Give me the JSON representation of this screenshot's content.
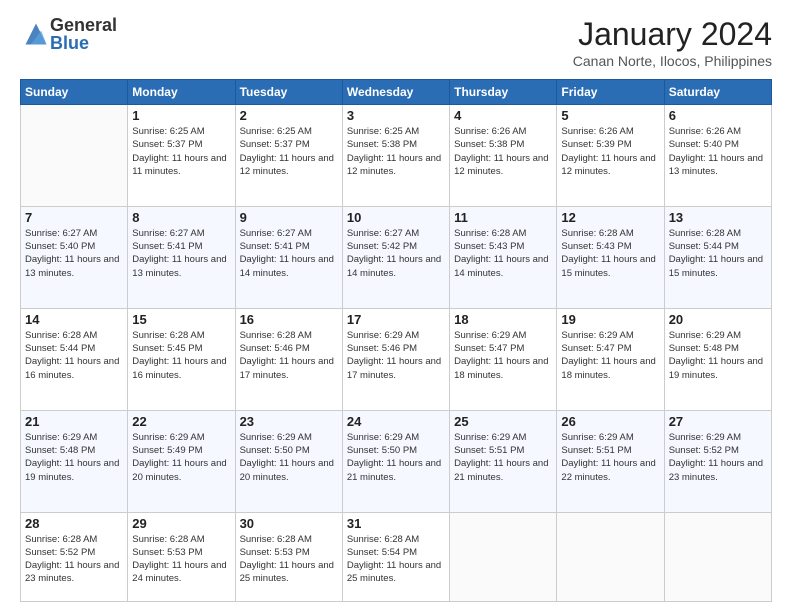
{
  "header": {
    "logo_general": "General",
    "logo_blue": "Blue",
    "month_title": "January 2024",
    "location": "Canan Norte, Ilocos, Philippines"
  },
  "days_of_week": [
    "Sunday",
    "Monday",
    "Tuesday",
    "Wednesday",
    "Thursday",
    "Friday",
    "Saturday"
  ],
  "weeks": [
    [
      {
        "day": "",
        "sunrise": "",
        "sunset": "",
        "daylight": ""
      },
      {
        "day": "1",
        "sunrise": "Sunrise: 6:25 AM",
        "sunset": "Sunset: 5:37 PM",
        "daylight": "Daylight: 11 hours and 11 minutes."
      },
      {
        "day": "2",
        "sunrise": "Sunrise: 6:25 AM",
        "sunset": "Sunset: 5:37 PM",
        "daylight": "Daylight: 11 hours and 12 minutes."
      },
      {
        "day": "3",
        "sunrise": "Sunrise: 6:25 AM",
        "sunset": "Sunset: 5:38 PM",
        "daylight": "Daylight: 11 hours and 12 minutes."
      },
      {
        "day": "4",
        "sunrise": "Sunrise: 6:26 AM",
        "sunset": "Sunset: 5:38 PM",
        "daylight": "Daylight: 11 hours and 12 minutes."
      },
      {
        "day": "5",
        "sunrise": "Sunrise: 6:26 AM",
        "sunset": "Sunset: 5:39 PM",
        "daylight": "Daylight: 11 hours and 12 minutes."
      },
      {
        "day": "6",
        "sunrise": "Sunrise: 6:26 AM",
        "sunset": "Sunset: 5:40 PM",
        "daylight": "Daylight: 11 hours and 13 minutes."
      }
    ],
    [
      {
        "day": "7",
        "sunrise": "Sunrise: 6:27 AM",
        "sunset": "Sunset: 5:40 PM",
        "daylight": "Daylight: 11 hours and 13 minutes."
      },
      {
        "day": "8",
        "sunrise": "Sunrise: 6:27 AM",
        "sunset": "Sunset: 5:41 PM",
        "daylight": "Daylight: 11 hours and 13 minutes."
      },
      {
        "day": "9",
        "sunrise": "Sunrise: 6:27 AM",
        "sunset": "Sunset: 5:41 PM",
        "daylight": "Daylight: 11 hours and 14 minutes."
      },
      {
        "day": "10",
        "sunrise": "Sunrise: 6:27 AM",
        "sunset": "Sunset: 5:42 PM",
        "daylight": "Daylight: 11 hours and 14 minutes."
      },
      {
        "day": "11",
        "sunrise": "Sunrise: 6:28 AM",
        "sunset": "Sunset: 5:43 PM",
        "daylight": "Daylight: 11 hours and 14 minutes."
      },
      {
        "day": "12",
        "sunrise": "Sunrise: 6:28 AM",
        "sunset": "Sunset: 5:43 PM",
        "daylight": "Daylight: 11 hours and 15 minutes."
      },
      {
        "day": "13",
        "sunrise": "Sunrise: 6:28 AM",
        "sunset": "Sunset: 5:44 PM",
        "daylight": "Daylight: 11 hours and 15 minutes."
      }
    ],
    [
      {
        "day": "14",
        "sunrise": "Sunrise: 6:28 AM",
        "sunset": "Sunset: 5:44 PM",
        "daylight": "Daylight: 11 hours and 16 minutes."
      },
      {
        "day": "15",
        "sunrise": "Sunrise: 6:28 AM",
        "sunset": "Sunset: 5:45 PM",
        "daylight": "Daylight: 11 hours and 16 minutes."
      },
      {
        "day": "16",
        "sunrise": "Sunrise: 6:28 AM",
        "sunset": "Sunset: 5:46 PM",
        "daylight": "Daylight: 11 hours and 17 minutes."
      },
      {
        "day": "17",
        "sunrise": "Sunrise: 6:29 AM",
        "sunset": "Sunset: 5:46 PM",
        "daylight": "Daylight: 11 hours and 17 minutes."
      },
      {
        "day": "18",
        "sunrise": "Sunrise: 6:29 AM",
        "sunset": "Sunset: 5:47 PM",
        "daylight": "Daylight: 11 hours and 18 minutes."
      },
      {
        "day": "19",
        "sunrise": "Sunrise: 6:29 AM",
        "sunset": "Sunset: 5:47 PM",
        "daylight": "Daylight: 11 hours and 18 minutes."
      },
      {
        "day": "20",
        "sunrise": "Sunrise: 6:29 AM",
        "sunset": "Sunset: 5:48 PM",
        "daylight": "Daylight: 11 hours and 19 minutes."
      }
    ],
    [
      {
        "day": "21",
        "sunrise": "Sunrise: 6:29 AM",
        "sunset": "Sunset: 5:48 PM",
        "daylight": "Daylight: 11 hours and 19 minutes."
      },
      {
        "day": "22",
        "sunrise": "Sunrise: 6:29 AM",
        "sunset": "Sunset: 5:49 PM",
        "daylight": "Daylight: 11 hours and 20 minutes."
      },
      {
        "day": "23",
        "sunrise": "Sunrise: 6:29 AM",
        "sunset": "Sunset: 5:50 PM",
        "daylight": "Daylight: 11 hours and 20 minutes."
      },
      {
        "day": "24",
        "sunrise": "Sunrise: 6:29 AM",
        "sunset": "Sunset: 5:50 PM",
        "daylight": "Daylight: 11 hours and 21 minutes."
      },
      {
        "day": "25",
        "sunrise": "Sunrise: 6:29 AM",
        "sunset": "Sunset: 5:51 PM",
        "daylight": "Daylight: 11 hours and 21 minutes."
      },
      {
        "day": "26",
        "sunrise": "Sunrise: 6:29 AM",
        "sunset": "Sunset: 5:51 PM",
        "daylight": "Daylight: 11 hours and 22 minutes."
      },
      {
        "day": "27",
        "sunrise": "Sunrise: 6:29 AM",
        "sunset": "Sunset: 5:52 PM",
        "daylight": "Daylight: 11 hours and 23 minutes."
      }
    ],
    [
      {
        "day": "28",
        "sunrise": "Sunrise: 6:28 AM",
        "sunset": "Sunset: 5:52 PM",
        "daylight": "Daylight: 11 hours and 23 minutes."
      },
      {
        "day": "29",
        "sunrise": "Sunrise: 6:28 AM",
        "sunset": "Sunset: 5:53 PM",
        "daylight": "Daylight: 11 hours and 24 minutes."
      },
      {
        "day": "30",
        "sunrise": "Sunrise: 6:28 AM",
        "sunset": "Sunset: 5:53 PM",
        "daylight": "Daylight: 11 hours and 25 minutes."
      },
      {
        "day": "31",
        "sunrise": "Sunrise: 6:28 AM",
        "sunset": "Sunset: 5:54 PM",
        "daylight": "Daylight: 11 hours and 25 minutes."
      },
      {
        "day": "",
        "sunrise": "",
        "sunset": "",
        "daylight": ""
      },
      {
        "day": "",
        "sunrise": "",
        "sunset": "",
        "daylight": ""
      },
      {
        "day": "",
        "sunrise": "",
        "sunset": "",
        "daylight": ""
      }
    ]
  ]
}
